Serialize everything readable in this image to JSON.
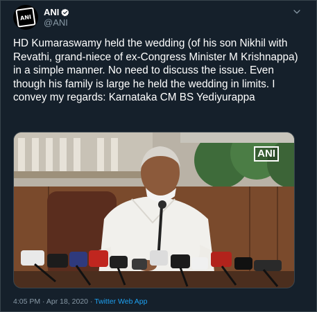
{
  "tweet": {
    "display_name": "ANI",
    "handle": "@ANI",
    "avatar_text": "ANI",
    "text": "HD Kumaraswamy held the wedding (of his son Nikhil with Revathi, grand-niece of ex-Congress Minister M Krishnappa) in a simple manner. No need to discuss the issue. Even though his family is large he held the wedding in limits. I convey my regards: Karnataka CM BS Yediyurappa",
    "media_watermark": "ANI",
    "time": "4:05 PM",
    "separator": "·",
    "date": "Apr 18, 2020",
    "source": "Twitter Web App"
  },
  "colors": {
    "background": "#15202b",
    "text": "#ffffff",
    "muted": "#8899a6",
    "accent": "#1da1f2",
    "border": "#38444d"
  },
  "icons": {
    "verified": "verified-badge-icon",
    "menu": "chevron-down-icon"
  }
}
